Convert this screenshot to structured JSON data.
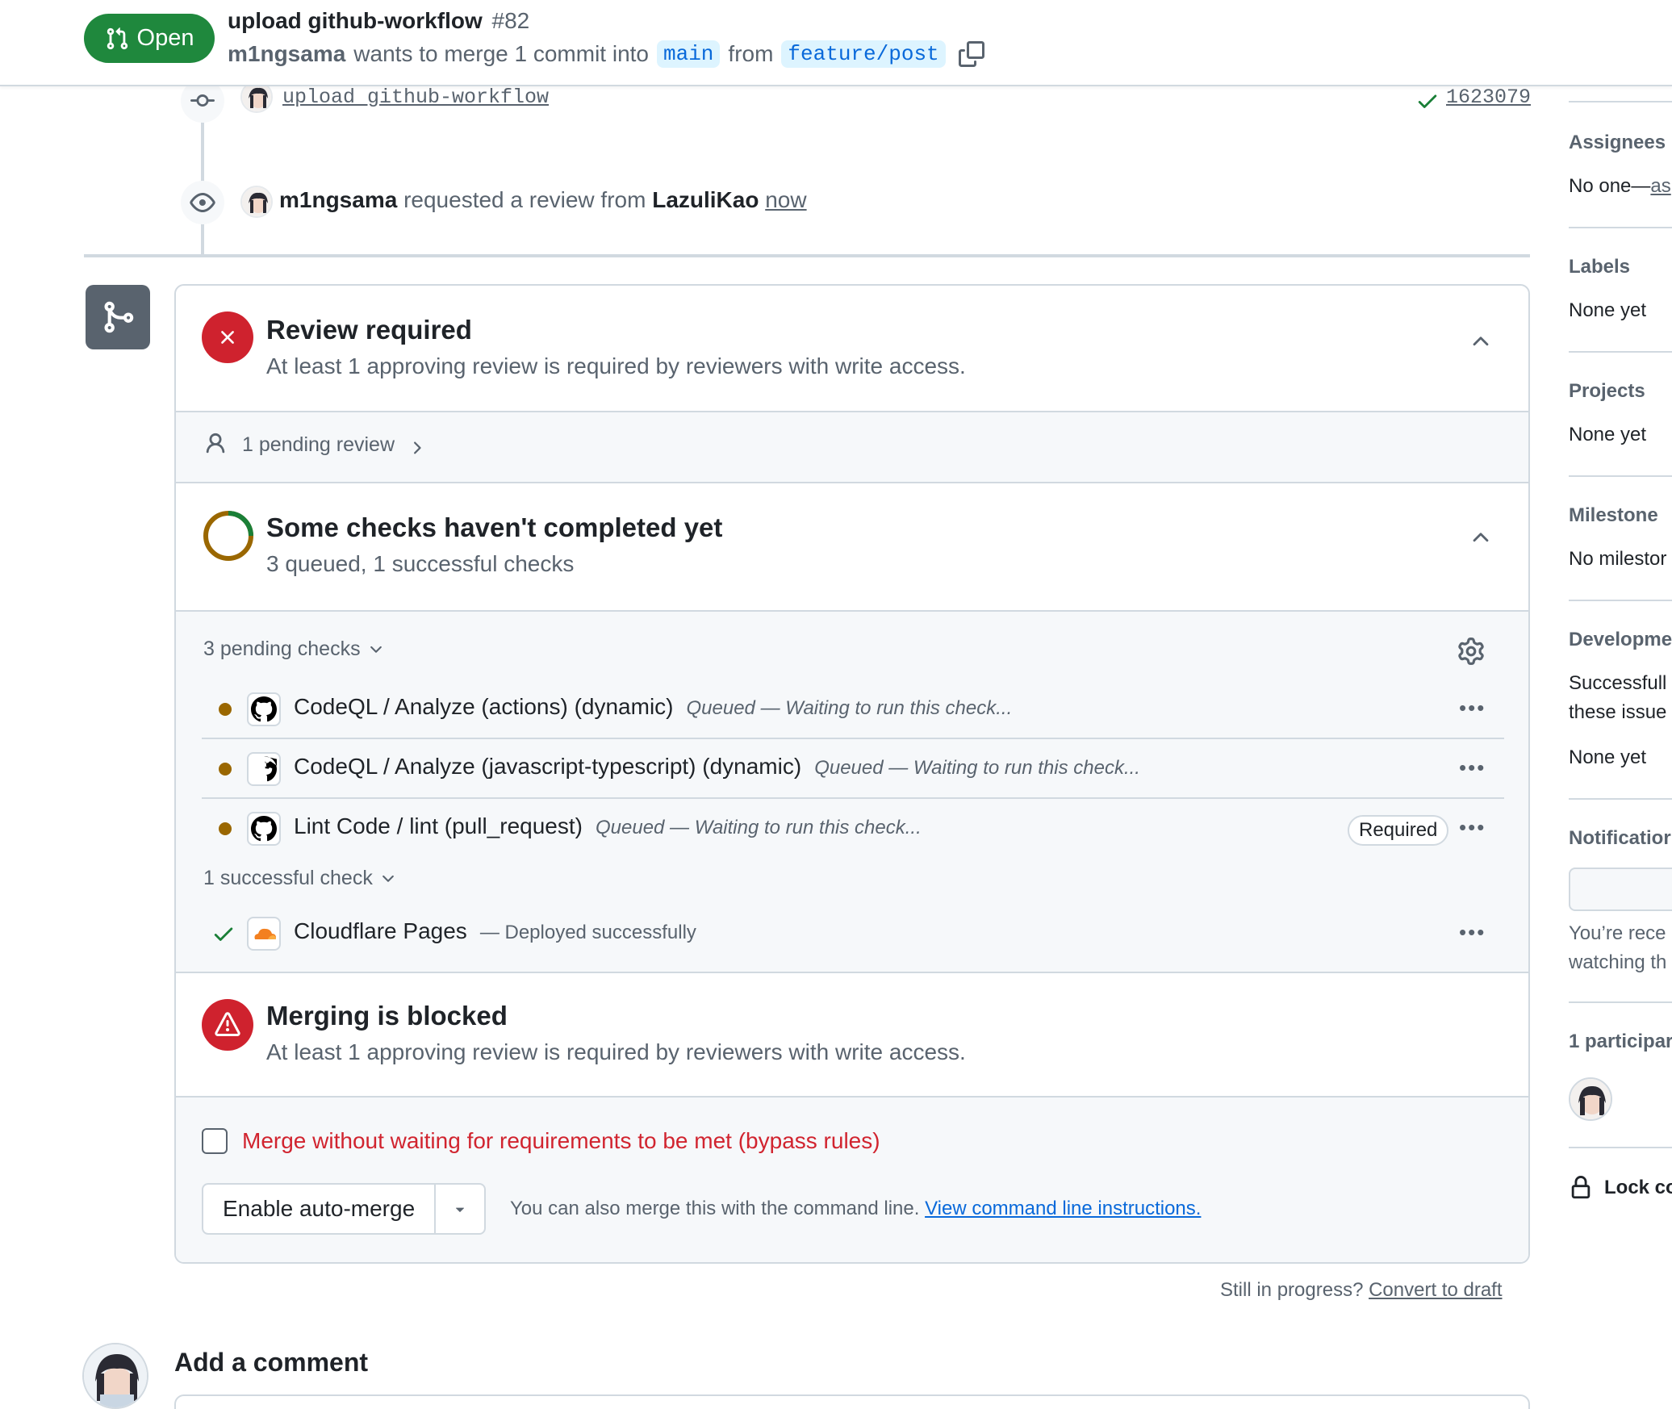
{
  "header": {
    "state_label": "Open",
    "title": "upload github-workflow",
    "number": "#82",
    "author": "m1ngsama",
    "merge_text": "wants to merge 1 commit into",
    "base_branch": "main",
    "from_text": "from",
    "head_branch": "feature/post"
  },
  "timeline": {
    "commit_message": "upload github-workflow",
    "commit_sha": "1623079",
    "review_actor": "m1ngsama",
    "review_text": "requested a review from",
    "reviewer": "LazuliKao",
    "review_time": "now"
  },
  "merge_box": {
    "review_title": "Review required",
    "review_subtitle": "At least 1 approving review is required by reviewers with write access.",
    "pending_review_label": "1 pending review",
    "checks_title": "Some checks haven't completed yet",
    "checks_subtitle": "3 queued, 1 successful checks",
    "pending_group_label": "3 pending checks",
    "pending_checks": [
      {
        "name": "CodeQL / Analyze (actions) (dynamic)",
        "status": "Queued — Waiting to run this check..."
      },
      {
        "name": "CodeQL / Analyze (javascript-typescript) (dynamic)",
        "status": "Queued — Waiting to run this check..."
      },
      {
        "name": "Lint Code / lint (pull_request)",
        "status": "Queued — Waiting to run this check...",
        "badge": "Required"
      }
    ],
    "success_group_label": "1 successful check",
    "success_checks": [
      {
        "name": "Cloudflare Pages",
        "status": "— Deployed successfully"
      }
    ],
    "blocked_title": "Merging is blocked",
    "blocked_subtitle": "At least 1 approving review is required by reviewers with write access.",
    "bypass_label": "Merge without waiting for requirements to be met (bypass rules)",
    "auto_merge_label": "Enable auto-merge",
    "cmd_text": "You can also merge this with the command line.",
    "cmd_link": "View command line instructions."
  },
  "draft": {
    "text": "Still in progress?",
    "link": "Convert to draft"
  },
  "comment": {
    "title": "Add a comment"
  },
  "sidebar": {
    "assignees_heading": "Assignees",
    "assignees_value": "No one—",
    "assignees_link": "as",
    "labels_heading": "Labels",
    "labels_value": "None yet",
    "projects_heading": "Projects",
    "projects_value": "None yet",
    "milestone_heading": "Milestone",
    "milestone_value": "No milestor",
    "development_heading": "Developme",
    "development_text_1": "Successfull",
    "development_text_2": "these issue",
    "development_value": "None yet",
    "notifications_heading": "Notificatior",
    "notifications_text_1": "You’re rece",
    "notifications_text_2": "watching th",
    "participants_heading": "1 participar",
    "lock_label": "Lock co"
  },
  "colors": {
    "open_green": "#1f883d",
    "danger_red": "#cf222e",
    "pending_amber": "#9a6700",
    "success_green": "#1a7f37",
    "link_blue": "#0969da"
  },
  "icons": [
    "git-pull-request-icon",
    "copy-icon",
    "git-commit-icon",
    "check-icon",
    "eye-icon",
    "git-merge-icon",
    "x-icon",
    "chevron-up-icon",
    "person-icon",
    "chevron-right-icon",
    "spinner-icon",
    "chevron-down-icon",
    "gear-icon",
    "github-logo-icon",
    "cloudflare-logo-icon",
    "alert-icon",
    "kebab-icon",
    "triangle-down-icon",
    "lock-icon"
  ]
}
